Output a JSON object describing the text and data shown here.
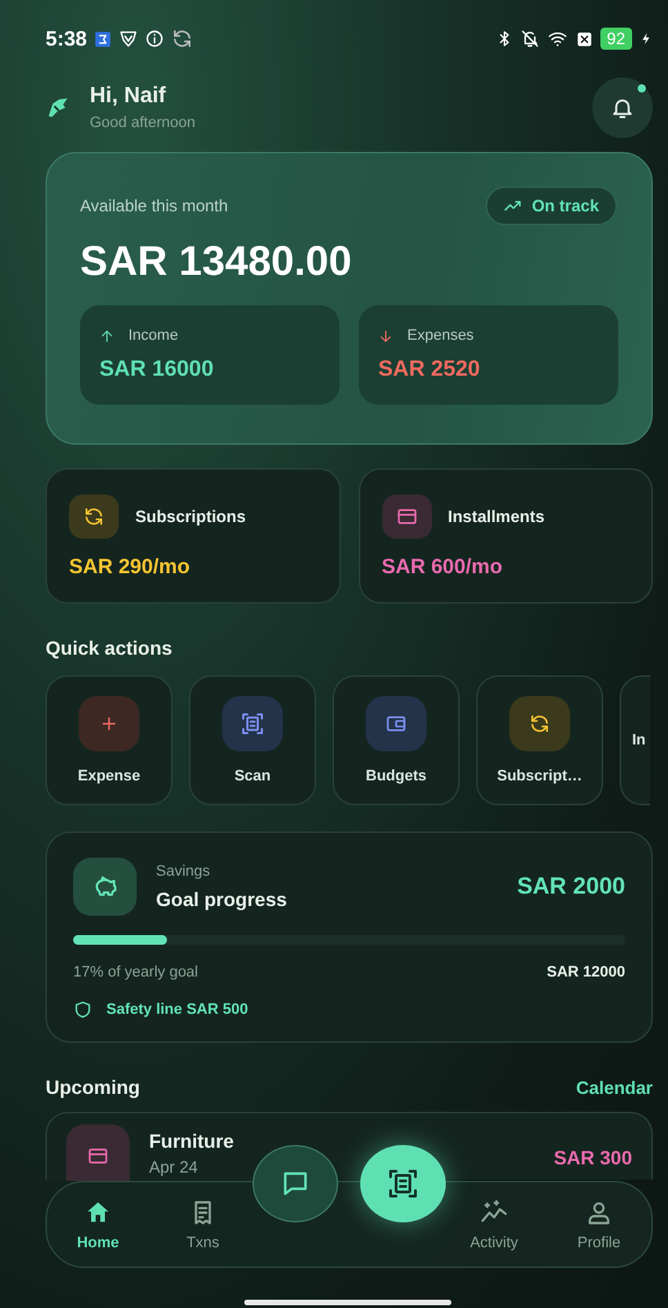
{
  "status_bar": {
    "time": "5:38",
    "battery": "92"
  },
  "header": {
    "greeting": "Hi, Naif",
    "subtitle": "Good afternoon",
    "notification_dot": true
  },
  "balance": {
    "label": "Available this month",
    "amount": "SAR 13480.00",
    "badge": "On track",
    "stats": [
      {
        "kind": "income",
        "label": "Income",
        "value": "SAR 16000"
      },
      {
        "kind": "expense",
        "label": "Expenses",
        "value": "SAR 2520"
      }
    ]
  },
  "recurring": [
    {
      "kind": "subscriptions",
      "label": "Subscriptions",
      "value": "SAR 290/mo"
    },
    {
      "kind": "installments",
      "label": "Installments",
      "value": "SAR 600/mo"
    }
  ],
  "quick_actions": {
    "title": "Quick actions",
    "items": [
      {
        "kind": "expense",
        "label": "Expense"
      },
      {
        "kind": "scan",
        "label": "Scan"
      },
      {
        "kind": "budgets",
        "label": "Budgets"
      },
      {
        "kind": "subscriptions",
        "label": "Subscript…"
      },
      {
        "kind": "partial",
        "label": "In"
      }
    ]
  },
  "savings": {
    "label": "Savings",
    "title": "Goal progress",
    "amount": "SAR 2000",
    "level": 0.17,
    "caption": "17% of yearly goal",
    "goal": "SAR 12000",
    "safety": "Safety line SAR 500"
  },
  "upcoming": {
    "title": "Upcoming",
    "link": "Calendar",
    "items": [
      {
        "kind": "installments",
        "name": "Furniture",
        "date": "Apr 24",
        "amount": "SAR 300"
      }
    ]
  },
  "nav": {
    "items": [
      {
        "kind": "home",
        "label": "Home",
        "selected": true
      },
      {
        "kind": "txns",
        "label": "Txns",
        "selected": false
      },
      {
        "kind": "activity",
        "label": "Activity",
        "selected": false
      },
      {
        "kind": "profile",
        "label": "Profile",
        "selected": false
      }
    ]
  }
}
